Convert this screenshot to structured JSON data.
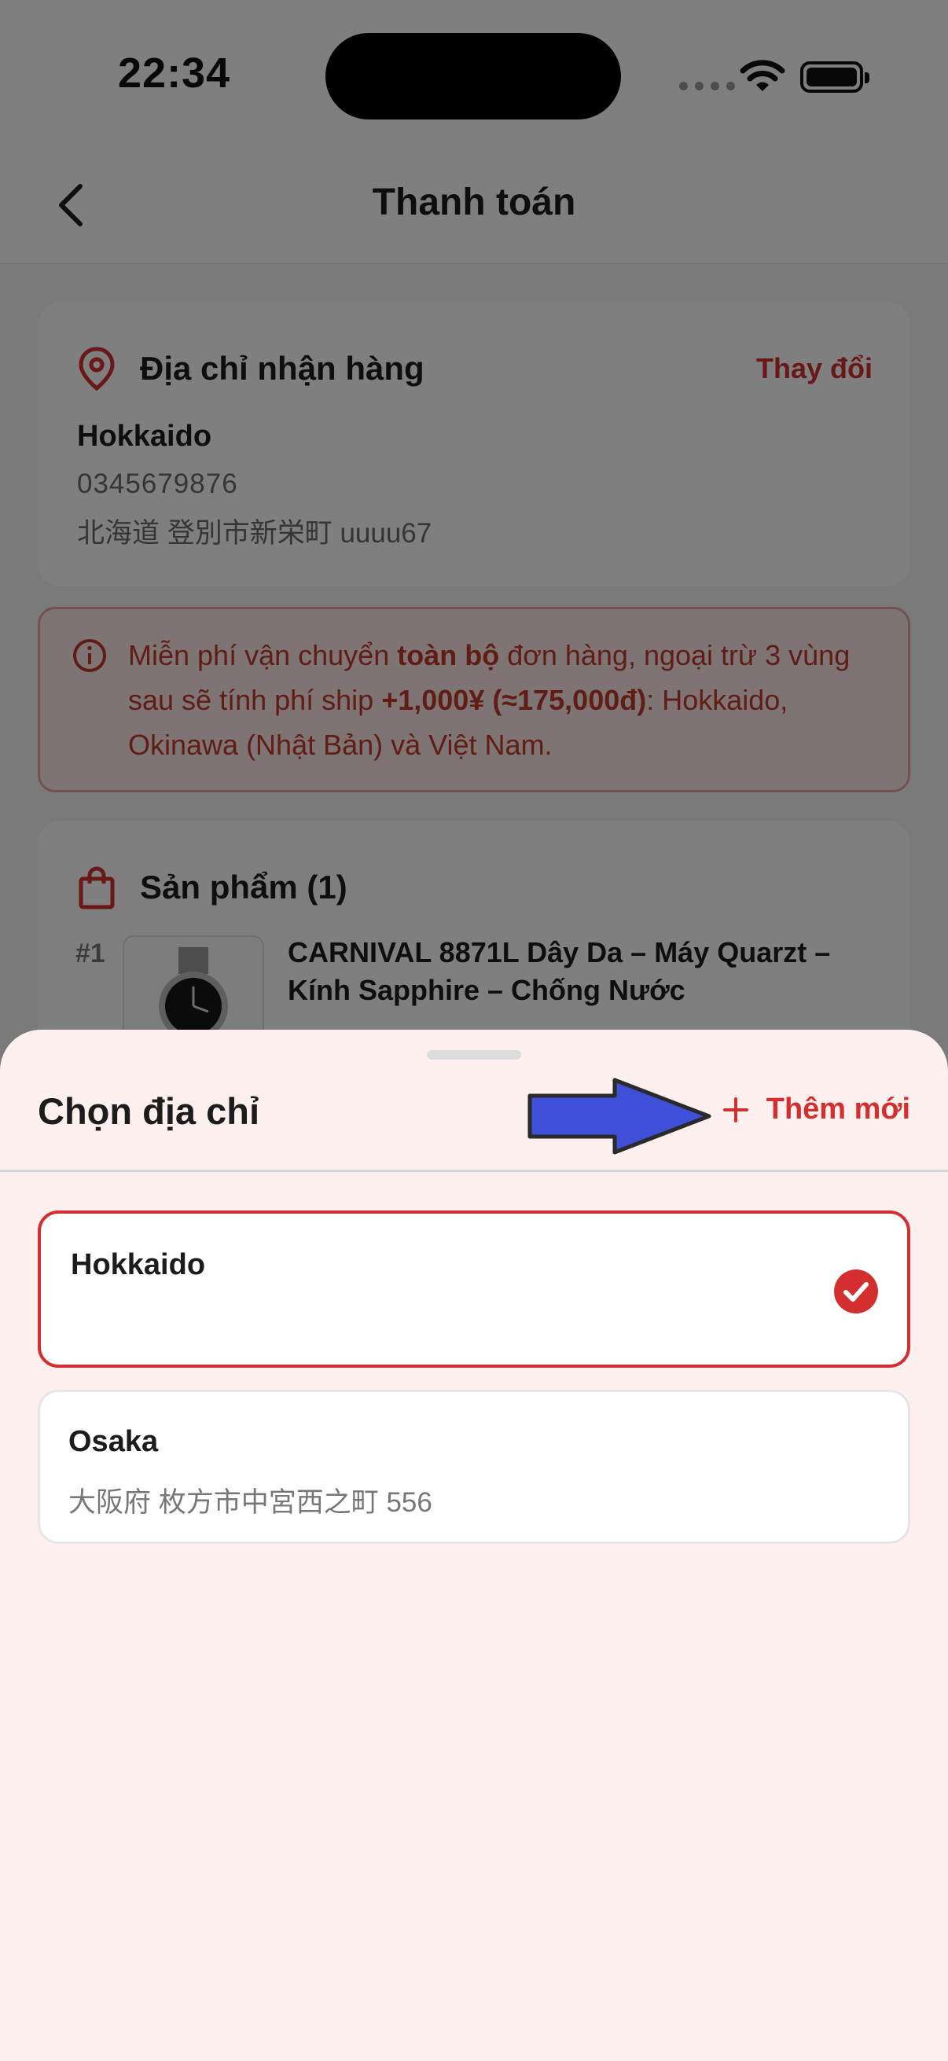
{
  "status_bar": {
    "time": "22:34"
  },
  "header": {
    "title": "Thanh toán"
  },
  "shipping_address": {
    "title": "Địa chỉ nhận hàng",
    "change_label": "Thay đổi",
    "name": "Hokkaido",
    "phone": "0345679876",
    "address": "北海道 登別市新栄町 uuuu67"
  },
  "notice": {
    "part1": "Miễn phí vận chuyển ",
    "bold1": "toàn bộ",
    "part2": " đơn hàng, ngoại trừ 3 vùng sau sẽ tính phí ship ",
    "bold2": "+1,000¥ (≈175,000đ)",
    "part3": ": Hokkaido, Okinawa (Nhật Bản) và Việt Nam."
  },
  "products": {
    "title": "Sản phẩm (1)",
    "items": [
      {
        "index": "#1",
        "name": "CARNIVAL 8871L Dây Da – Máy Quarzt – Kính Sapphire – Chống Nước"
      }
    ]
  },
  "sheet": {
    "title": "Chọn địa chỉ",
    "add_new_label": "Thêm mới",
    "options": [
      {
        "name": "Hokkaido",
        "address": "",
        "selected": true
      },
      {
        "name": "Osaka",
        "address": "大阪府 枚方市中宮西之町 556",
        "selected": false
      }
    ]
  },
  "colors": {
    "accent": "#d32f2f",
    "sheet_bg": "#fff0f0",
    "annotation_arrow": "#3f4fd8"
  },
  "icons": [
    "chevron-left-icon",
    "location-pin-icon",
    "info-icon",
    "shopping-bag-icon",
    "plus-icon",
    "check-circle-icon",
    "wifi-icon",
    "battery-icon"
  ]
}
